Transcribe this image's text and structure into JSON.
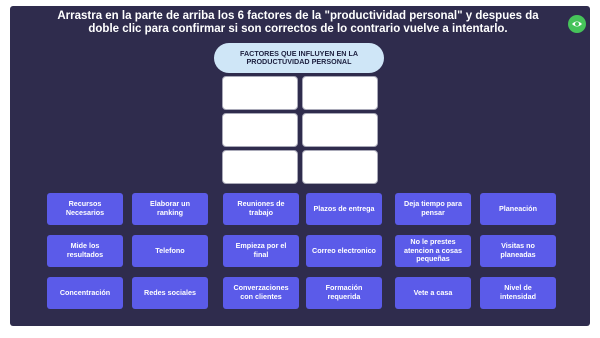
{
  "instructions": "Arrastra en la parte de arriba los 6 factores de la \"productividad personal\" y despues da doble clic para confirmar si son correctos de lo contrario vuelve a intentarlo.",
  "eye_button_icon": "eye-icon",
  "drop_area": {
    "header": "FACTORES QUE INFLUYEN EN LA PRODUCTUVIDAD PERSONAL",
    "slot_count": 6
  },
  "tiles": [
    [
      "Recursos Necesarios",
      "Elaborar un ranking",
      "Reuniones de trabajo",
      "Plazos de entrega",
      "Deja tiempo para pensar",
      "Planeación"
    ],
    [
      "Mide los resultados",
      "Telefono",
      "Empieza por el final",
      "Correo electronico",
      "No le prestes atencion a cosas pequeñas",
      "Visitas no planeadas"
    ],
    [
      "Concentración",
      "Redes sociales",
      "Converzaciones con clientes",
      "Formación requerida",
      "Vete a casa",
      "Nivel de intensidad"
    ]
  ],
  "colors": {
    "background": "#2f2c4d",
    "tile": "#5b5be9",
    "header_pill": "#cfe6f7",
    "eye_button": "#46c35a"
  }
}
